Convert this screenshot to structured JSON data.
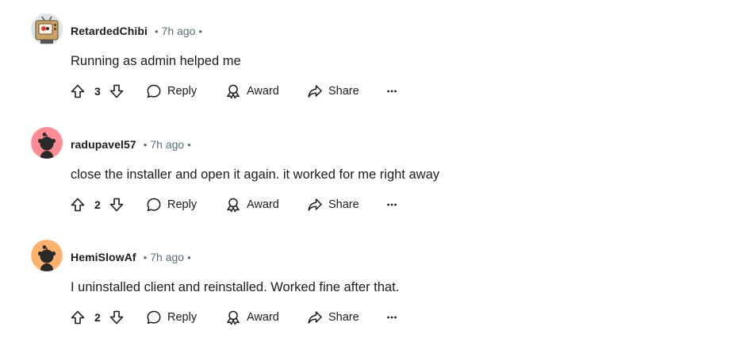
{
  "comments": [
    {
      "username": "RetardedChibi",
      "separator": "•",
      "time": "7h ago",
      "trailing_separator": "•",
      "avatar_icon": "robot-tv-avatar-icon",
      "text": "Running as admin helped me",
      "score": "3",
      "reply_label": "Reply",
      "award_label": "Award",
      "share_label": "Share",
      "more_label": "···"
    },
    {
      "username": "radupavel57",
      "separator": "•",
      "time": "7h ago",
      "trailing_separator": "•",
      "avatar_icon": "snoo-avatar-icon",
      "avatar_color": "#ff8c95",
      "text": "close the installer and open it again. it worked for me right away",
      "score": "2",
      "reply_label": "Reply",
      "award_label": "Award",
      "share_label": "Share",
      "more_label": "···"
    },
    {
      "username": "HemiSlowAf",
      "separator": "•",
      "time": "7h ago",
      "trailing_separator": "•",
      "avatar_icon": "snoo-avatar-icon",
      "avatar_color": "#ffb26e",
      "text": "I uninstalled client and reinstalled. Worked fine after that.",
      "score": "2",
      "reply_label": "Reply",
      "award_label": "Award",
      "share_label": "Share",
      "more_label": "···"
    }
  ],
  "icons": {
    "upvote": "upvote-arrow-icon",
    "downvote": "downvote-arrow-icon",
    "reply": "speech-bubble-icon",
    "award": "award-ribbon-icon",
    "share": "share-arrow-icon",
    "more": "more-options-icon"
  }
}
